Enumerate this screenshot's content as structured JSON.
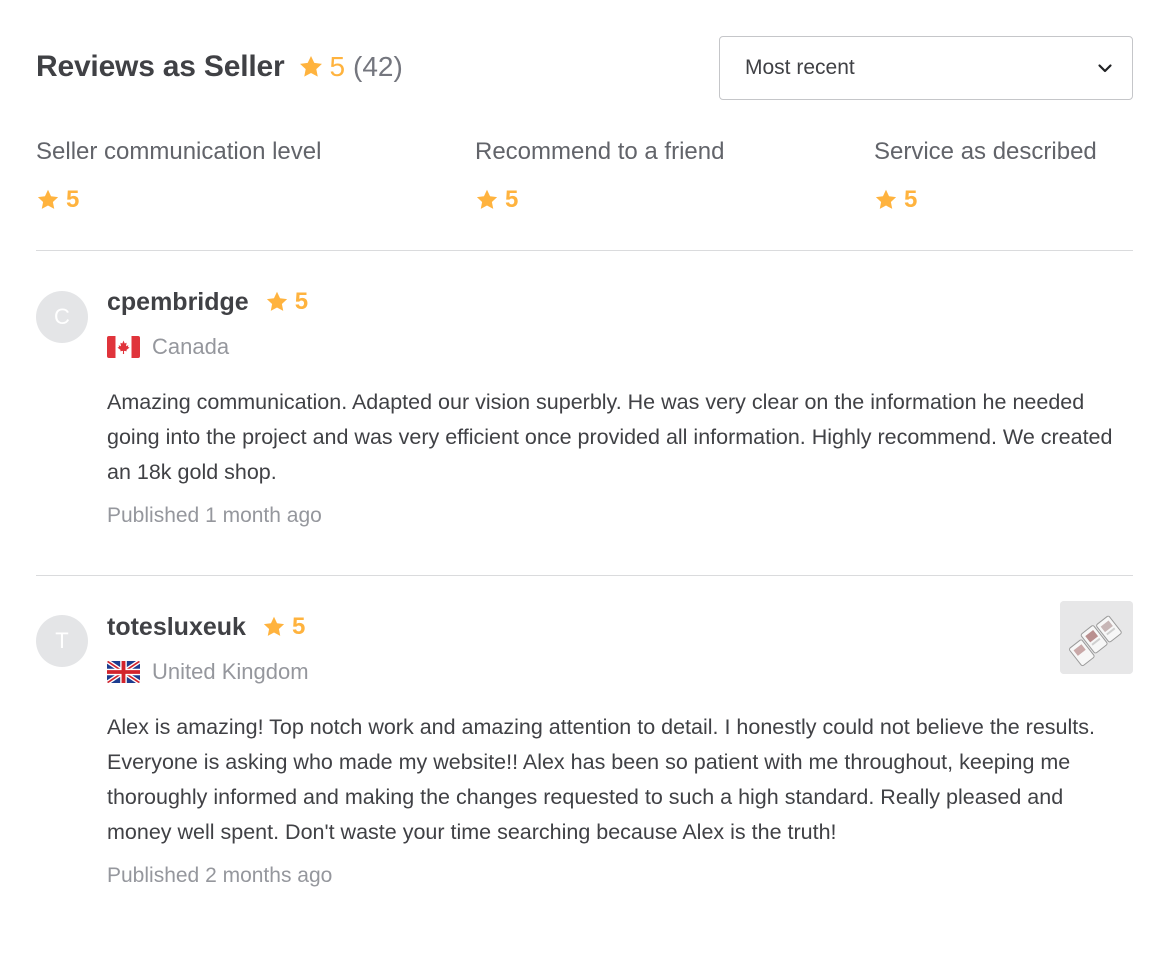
{
  "header": {
    "title": "Reviews as Seller",
    "rating": "5",
    "count": "(42)",
    "star_icon": "star-icon"
  },
  "sort": {
    "selected": "Most recent",
    "icon": "chevron-down-icon"
  },
  "breakdown": [
    {
      "label": "Seller communication level",
      "rating": "5"
    },
    {
      "label": "Recommend to a friend",
      "rating": "5"
    },
    {
      "label": "Service as described",
      "rating": "5"
    }
  ],
  "reviews": [
    {
      "avatar_initial": "C",
      "username": "cpembridge",
      "rating": "5",
      "country": "Canada",
      "flag_icon": "canada-flag-icon",
      "text": "Amazing communication. Adapted our vision superbly. He was very clear on the information he needed going into the project and was very efficient once provided all information. Highly recommend. We created an 18k gold shop.",
      "published": "Published 1 month ago"
    },
    {
      "avatar_initial": "T",
      "username": "totesluxeuk",
      "rating": "5",
      "country": "United Kingdom",
      "flag_icon": "uk-flag-icon",
      "text": "Alex is amazing! Top notch work and amazing attention to detail. I honestly could not believe the results. Everyone is asking who made my website!! Alex has been so patient with me throughout, keeping me thoroughly informed and making the changes requested to such a high standard. Really pleased and money well spent. Don't waste your time searching because Alex is the truth!",
      "published": "Published 2 months ago",
      "attachment_icon": "phone-screens-thumbnail"
    }
  ],
  "colors": {
    "star": "#ffb33e",
    "text": "#404145",
    "muted": "#95979d",
    "divider": "#dadbdd"
  }
}
